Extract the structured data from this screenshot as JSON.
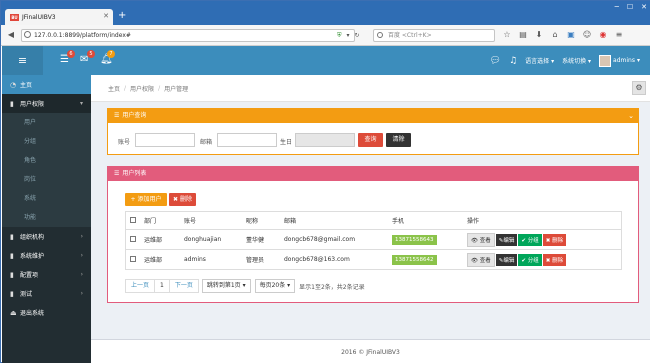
{
  "browser": {
    "tab_title": "JFinalUIBV3",
    "tab_favicon": "BU",
    "url": "127.0.0.1:8899/platform/index#",
    "search_placeholder": "百度 <Ctrl+K>"
  },
  "header": {
    "badges": {
      "tasks": "6",
      "messages": "5",
      "notifications": "7"
    },
    "language_label": "语言选择",
    "theme_label": "系统切换",
    "user_name": "admins"
  },
  "sidebar": {
    "items": [
      {
        "label": "主页",
        "icon": "dashboard-icon"
      },
      {
        "label": "用户权限",
        "icon": "book-icon"
      },
      {
        "label": "组织机构",
        "icon": "book-icon"
      },
      {
        "label": "系统维护",
        "icon": "book-icon"
      },
      {
        "label": "配置项",
        "icon": "book-icon"
      },
      {
        "label": "测试",
        "icon": "book-icon"
      },
      {
        "label": "退出系统",
        "icon": "logout-icon"
      }
    ],
    "sub_items": [
      "用户",
      "分组",
      "角色",
      "岗位",
      "系统",
      "功能"
    ]
  },
  "breadcrumb": [
    "主页",
    "用户权限",
    "用户管理"
  ],
  "query_panel": {
    "title": "用户查询",
    "account_label": "账号",
    "email_label": "邮箱",
    "birthday_label": "生日",
    "query_button": "查询",
    "clear_button": "清除"
  },
  "list_panel": {
    "title": "用户列表",
    "add_button": "+ 添加用户",
    "delete_button": "✖ 删除",
    "columns": [
      "部门",
      "账号",
      "昵称",
      "邮箱",
      "手机",
      "操作"
    ],
    "rows": [
      {
        "dept": "运维部",
        "account": "donghuajian",
        "nickname": "董华健",
        "email": "dongcb678@gmail.com",
        "phone": "13871558643"
      },
      {
        "dept": "运维部",
        "account": "admins",
        "nickname": "管理员",
        "email": "dongcb678@163.com",
        "phone": "13871558642"
      }
    ],
    "actions": {
      "view": "查看",
      "edit": "编辑",
      "group": "分组",
      "delete": "删除"
    }
  },
  "pager": {
    "prev": "上一页",
    "current": "1",
    "next": "下一页",
    "jump": "跳转到第1页",
    "per_page": "每页20条",
    "info": "显示1至2条，共2条记录"
  },
  "footer": "2016 © JFinalUIBV3",
  "colors": {
    "header": "#3c8dbc",
    "sidebar": "#222d32",
    "query_panel": "#f39c12",
    "list_panel": "#e25c7c",
    "phone_badge": "#8bc34a"
  }
}
